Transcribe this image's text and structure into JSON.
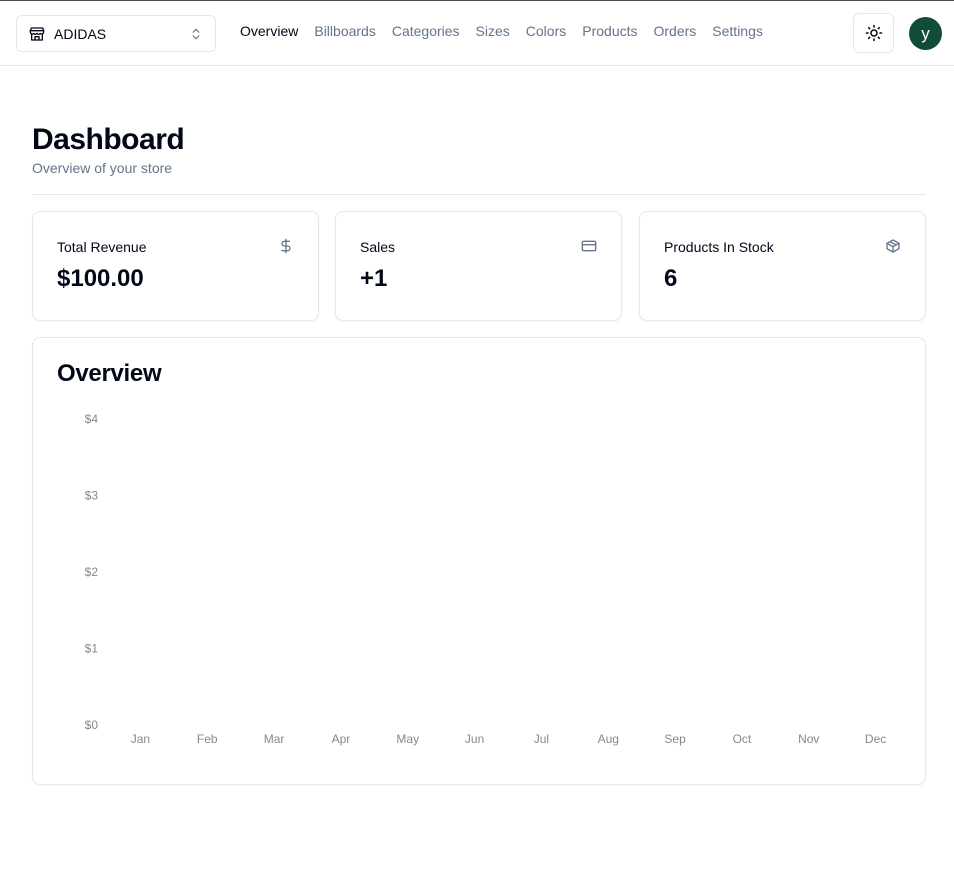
{
  "header": {
    "store": {
      "name": "ADIDAS",
      "icon": "store-icon",
      "chevron": "chevrons-up-down-icon"
    },
    "nav": [
      {
        "label": "Overview",
        "active": true
      },
      {
        "label": "Billboards",
        "active": false
      },
      {
        "label": "Categories",
        "active": false
      },
      {
        "label": "Sizes",
        "active": false
      },
      {
        "label": "Colors",
        "active": false
      },
      {
        "label": "Products",
        "active": false
      },
      {
        "label": "Orders",
        "active": false
      },
      {
        "label": "Settings",
        "active": false
      }
    ],
    "theme_toggle": {
      "icon": "sun-icon"
    },
    "avatar": {
      "initial": "y",
      "color": "#0f4c3a"
    }
  },
  "page": {
    "title": "Dashboard",
    "subtitle": "Overview of your store"
  },
  "stats": [
    {
      "title": "Total Revenue",
      "value": "$100.00",
      "icon": "dollar-sign-icon"
    },
    {
      "title": "Sales",
      "value": "+1",
      "icon": "credit-card-icon"
    },
    {
      "title": "Products In Stock",
      "value": "6",
      "icon": "package-icon"
    }
  ],
  "overview": {
    "title": "Overview"
  },
  "chart_data": {
    "type": "bar",
    "title": "Overview",
    "categories": [
      "Jan",
      "Feb",
      "Mar",
      "Apr",
      "May",
      "Jun",
      "Jul",
      "Aug",
      "Sep",
      "Oct",
      "Nov",
      "Dec"
    ],
    "values": [
      0,
      0,
      0,
      0,
      0,
      0,
      0,
      0,
      0,
      0,
      0,
      0
    ],
    "y_ticks": [
      "$0",
      "$1",
      "$2",
      "$3",
      "$4"
    ],
    "ylim": [
      0,
      4
    ],
    "grid": false,
    "bar_color": "#3498db"
  }
}
